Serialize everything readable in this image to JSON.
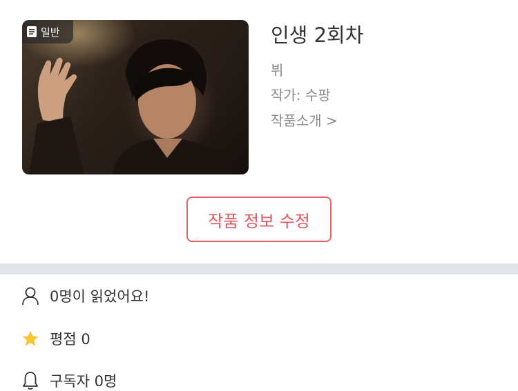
{
  "work": {
    "genre_badge": "일반",
    "title": "인생 2회차",
    "character": "뷔",
    "author": "작가: 수팡",
    "intro_link": "작품소개 >"
  },
  "actions": {
    "edit_label": "작품 정보 수정"
  },
  "stats": {
    "readers": "0명이 읽었어요!",
    "rating": "평점 0",
    "subscribers": "구독자 0명"
  },
  "icons": {
    "genre": "document-icon",
    "readers": "person-icon",
    "rating": "star-icon",
    "subscribers": "bell-icon"
  },
  "colors": {
    "accent": "#e6555c",
    "star": "#f6c531",
    "divider": "#e1e4e9"
  }
}
